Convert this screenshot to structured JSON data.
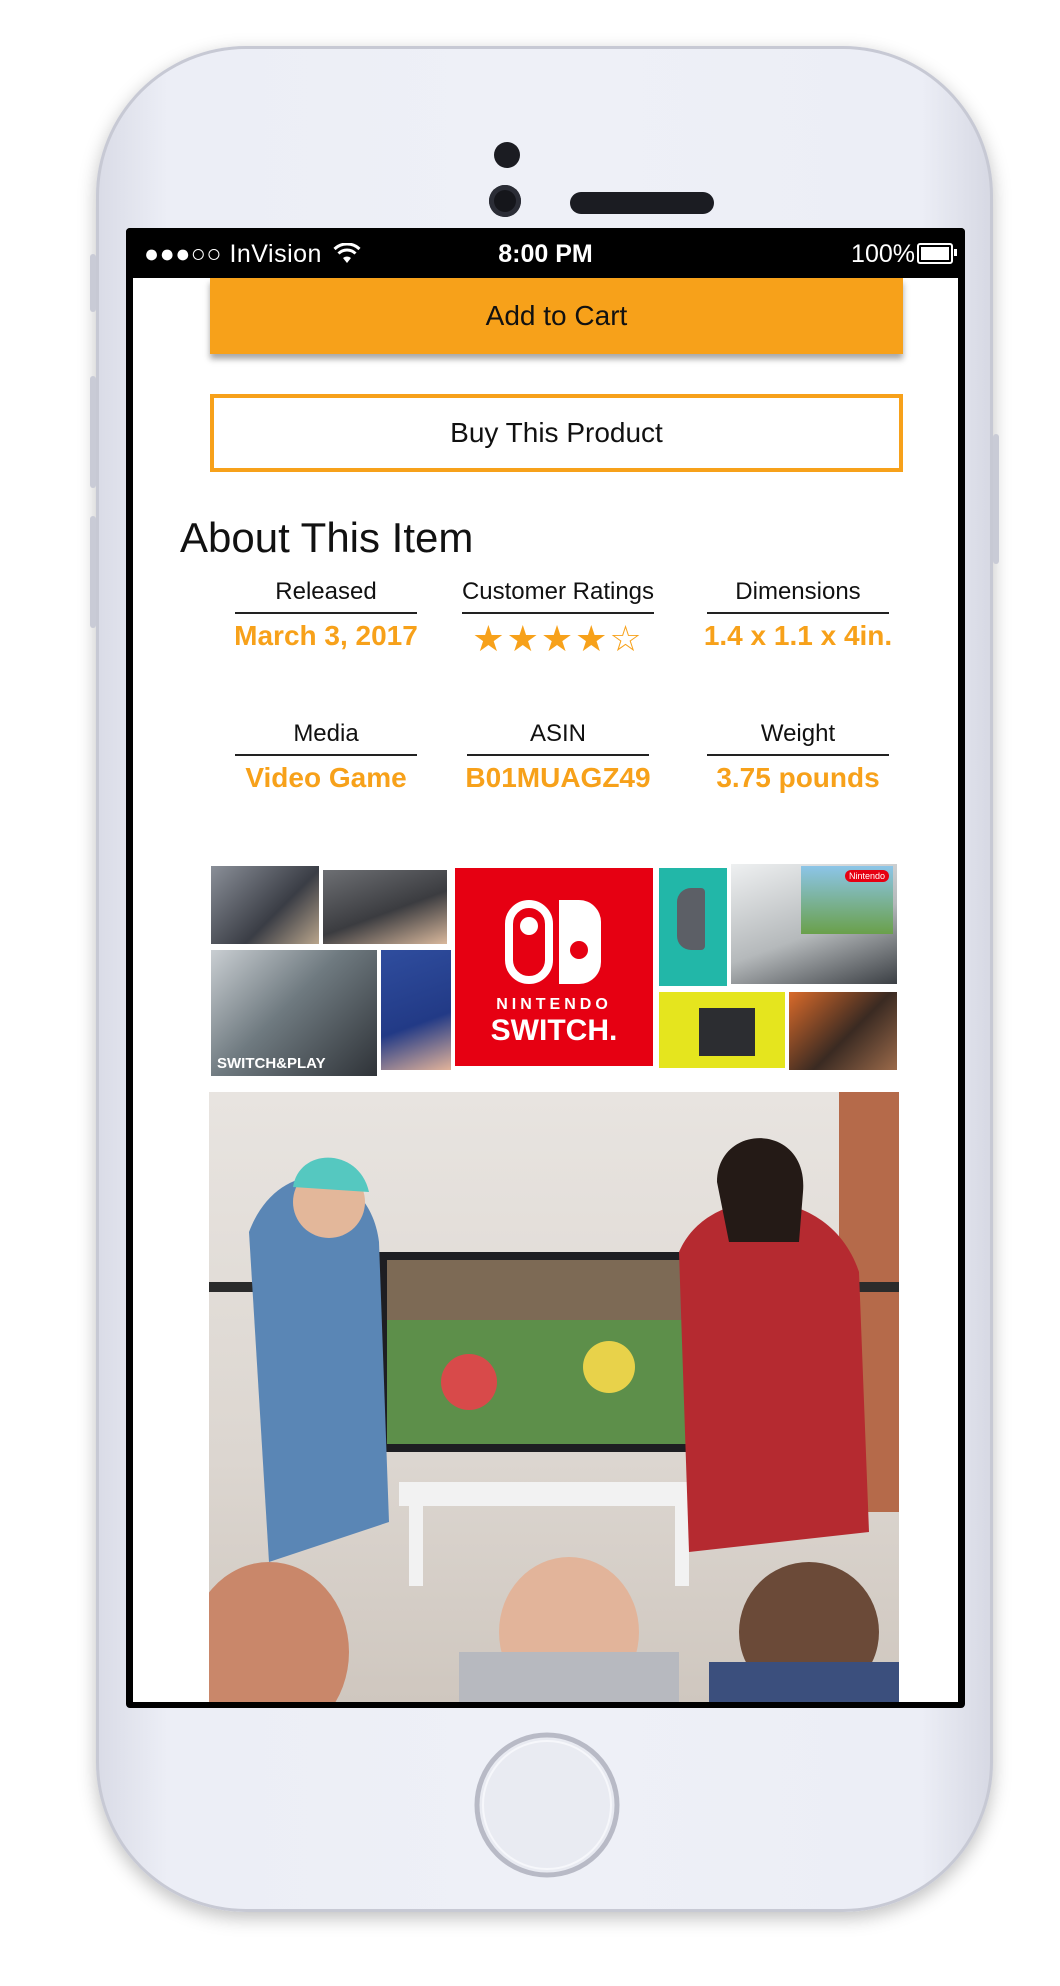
{
  "status_bar": {
    "carrier": "●●●○○ InVision",
    "time": "8:00 PM",
    "battery": "100%"
  },
  "actions": {
    "add_to_cart": "Add to Cart",
    "buy_product": "Buy This Product"
  },
  "about": {
    "title": "About This Item",
    "specs": [
      {
        "label": "Released",
        "value": "March 3, 2017"
      },
      {
        "label": "Customer Ratings",
        "rating": 4,
        "rating_max": 5
      },
      {
        "label": "Dimensions",
        "value": "1.4 x 1.1 x 4in."
      },
      {
        "label": "Media",
        "value": "Video Game"
      },
      {
        "label": "ASIN",
        "value": "B01MUAGZ49"
      },
      {
        "label": "Weight",
        "value": "3.75 pounds"
      }
    ]
  },
  "collage": {
    "logo_text_1": "NINTENDO",
    "logo_text_2": "SWITCH.",
    "caption": "SWITCH&PLAY",
    "brand_badge": "Nintendo"
  },
  "colors": {
    "accent": "#f7a11a",
    "switch_red": "#e60012"
  }
}
